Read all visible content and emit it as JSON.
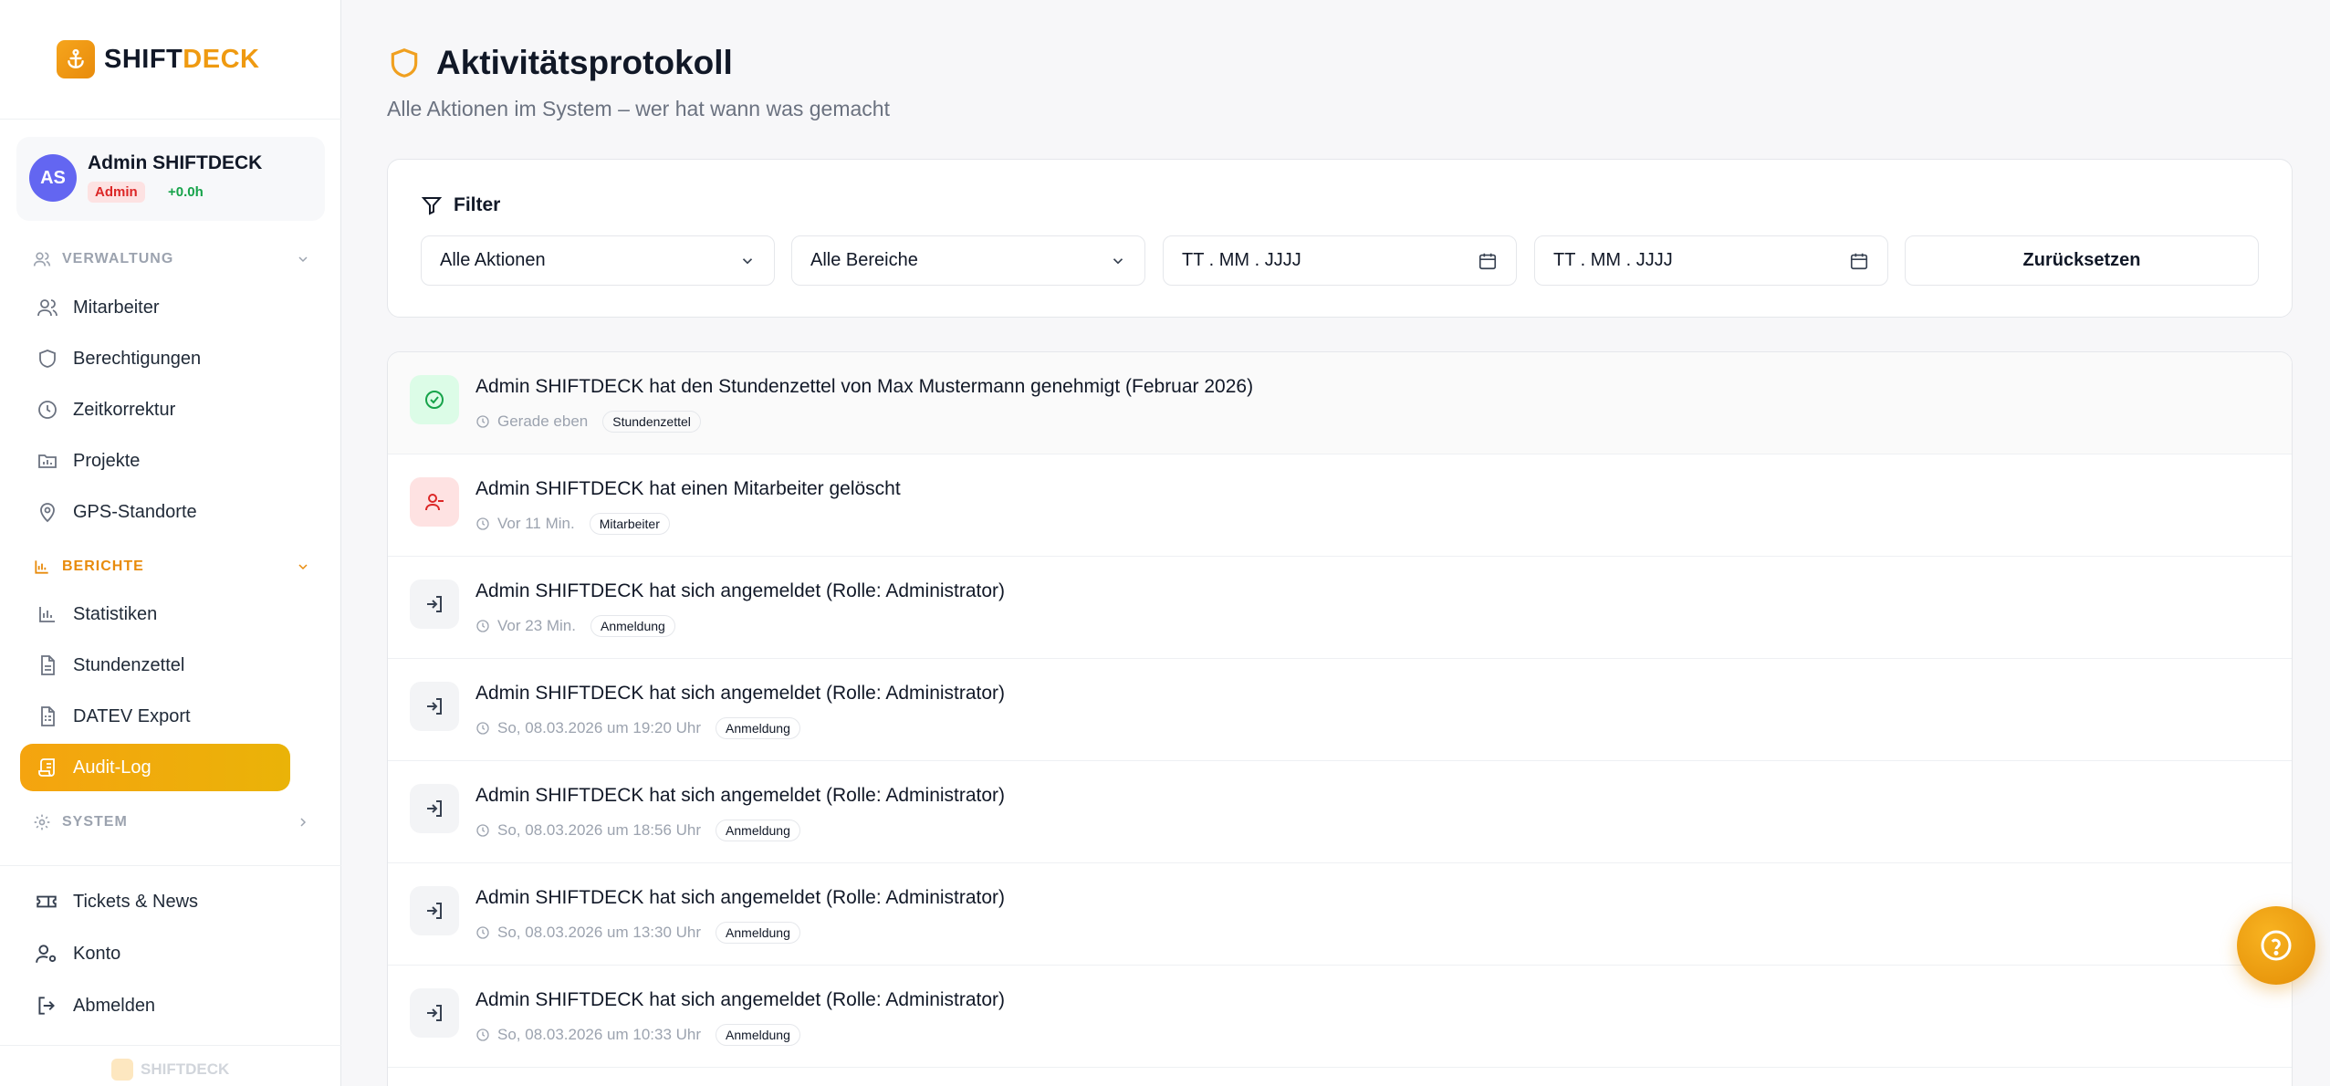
{
  "brand": {
    "name_part1": "SHIFT",
    "name_part2": "DECK",
    "accent_color": "#ef9a11"
  },
  "user": {
    "initials": "AS",
    "name": "Admin SHIFTDECK",
    "role": "Admin",
    "hours": "+0.0h"
  },
  "sidebar": {
    "sections": [
      {
        "label": "VERWALTUNG",
        "icon": "users-icon",
        "items": [
          {
            "label": "Mitarbeiter",
            "icon": "users-icon"
          },
          {
            "label": "Berechtigungen",
            "icon": "shield-icon"
          },
          {
            "label": "Zeitkorrektur",
            "icon": "clock-icon"
          },
          {
            "label": "Projekte",
            "icon": "folder-icon"
          },
          {
            "label": "GPS-Standorte",
            "icon": "map-pin-icon"
          }
        ]
      },
      {
        "label": "BERICHTE",
        "icon": "bar-chart-icon",
        "items": [
          {
            "label": "Statistiken",
            "icon": "bar-chart-icon"
          },
          {
            "label": "Stundenzettel",
            "icon": "file-icon"
          },
          {
            "label": "DATEV Export",
            "icon": "file-spreadsheet-icon"
          },
          {
            "label": "Audit-Log",
            "icon": "scroll-icon",
            "active": true
          }
        ]
      },
      {
        "label": "SYSTEM",
        "icon": "gear-icon",
        "items": []
      }
    ],
    "bottom": [
      {
        "label": "Tickets & News",
        "icon": "ticket-icon"
      },
      {
        "label": "Konto",
        "icon": "user-cog-icon"
      },
      {
        "label": "Abmelden",
        "icon": "logout-icon"
      }
    ],
    "footer": "SHIFTDECK"
  },
  "page": {
    "title": "Aktivitätsprotokoll",
    "subtitle": "Alle Aktionen im System – wer hat wann was gemacht"
  },
  "filter": {
    "label": "Filter",
    "action_select": "Alle Aktionen",
    "area_select": "Alle Bereiche",
    "date_from_placeholder": "TT . MM . JJJJ",
    "date_to_placeholder": "TT . MM . JJJJ",
    "reset_label": "Zurücksetzen"
  },
  "entries": [
    {
      "text": "Admin SHIFTDECK hat den Stundenzettel von Max Mustermann genehmigt (Februar 2026)",
      "time": "Gerade eben",
      "tag": "Stundenzettel",
      "icon": "check-circle-icon",
      "tone": "green"
    },
    {
      "text": "Admin SHIFTDECK hat einen Mitarbeiter gelöscht",
      "time": "Vor 11 Min.",
      "tag": "Mitarbeiter",
      "icon": "user-minus-icon",
      "tone": "red"
    },
    {
      "text": "Admin SHIFTDECK hat sich angemeldet (Rolle: Administrator)",
      "time": "Vor 23 Min.",
      "tag": "Anmeldung",
      "icon": "login-icon",
      "tone": "gray"
    },
    {
      "text": "Admin SHIFTDECK hat sich angemeldet (Rolle: Administrator)",
      "time": "So, 08.03.2026 um 19:20 Uhr",
      "tag": "Anmeldung",
      "icon": "login-icon",
      "tone": "gray"
    },
    {
      "text": "Admin SHIFTDECK hat sich angemeldet (Rolle: Administrator)",
      "time": "So, 08.03.2026 um 18:56 Uhr",
      "tag": "Anmeldung",
      "icon": "login-icon",
      "tone": "gray"
    },
    {
      "text": "Admin SHIFTDECK hat sich angemeldet (Rolle: Administrator)",
      "time": "So, 08.03.2026 um 13:30 Uhr",
      "tag": "Anmeldung",
      "icon": "login-icon",
      "tone": "gray"
    },
    {
      "text": "Admin SHIFTDECK hat sich angemeldet (Rolle: Administrator)",
      "time": "So, 08.03.2026 um 10:33 Uhr",
      "tag": "Anmeldung",
      "icon": "login-icon",
      "tone": "gray"
    }
  ],
  "help_icon": "help-circle-icon"
}
